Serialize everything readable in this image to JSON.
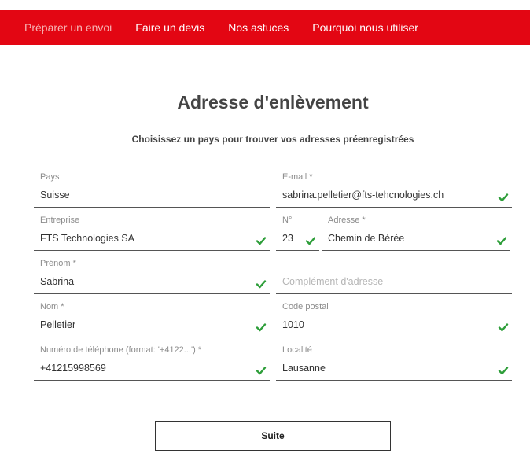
{
  "nav": {
    "items": [
      {
        "label": "Préparer un envoi",
        "active": true
      },
      {
        "label": "Faire un devis",
        "active": false
      },
      {
        "label": "Nos astuces",
        "active": false
      },
      {
        "label": "Pourquoi nous utiliser",
        "active": false
      }
    ]
  },
  "page": {
    "title": "Adresse d'enlèvement",
    "subtitle": "Choisissez un pays pour trouver vos adresses préenregistrées"
  },
  "form": {
    "country": {
      "label": "Pays",
      "value": "Suisse"
    },
    "email": {
      "label": "E-mail *",
      "value": "sabrina.pelletier@fts-tehcnologies.ch"
    },
    "company": {
      "label": "Entreprise",
      "value": "FTS Technologies SA"
    },
    "number": {
      "label": "N°",
      "value": "23"
    },
    "address": {
      "label": "Adresse *",
      "value": "Chemin de Bérée"
    },
    "firstname": {
      "label": "Prénom *",
      "value": "Sabrina"
    },
    "address_extra": {
      "placeholder": "Complément d'adresse"
    },
    "lastname": {
      "label": "Nom *",
      "value": "Pelletier"
    },
    "postal_code": {
      "label": "Code postal",
      "value": "1010"
    },
    "phone": {
      "label": "Numéro de téléphone (format: '+4122...') *",
      "value": "+41215998569"
    },
    "city": {
      "label": "Localité",
      "value": "Lausanne"
    }
  },
  "actions": {
    "next_label": "Suite"
  },
  "colors": {
    "brand": "#e30613",
    "valid": "#2e9e3a"
  },
  "icons": {
    "valid": "checkmark-icon"
  }
}
